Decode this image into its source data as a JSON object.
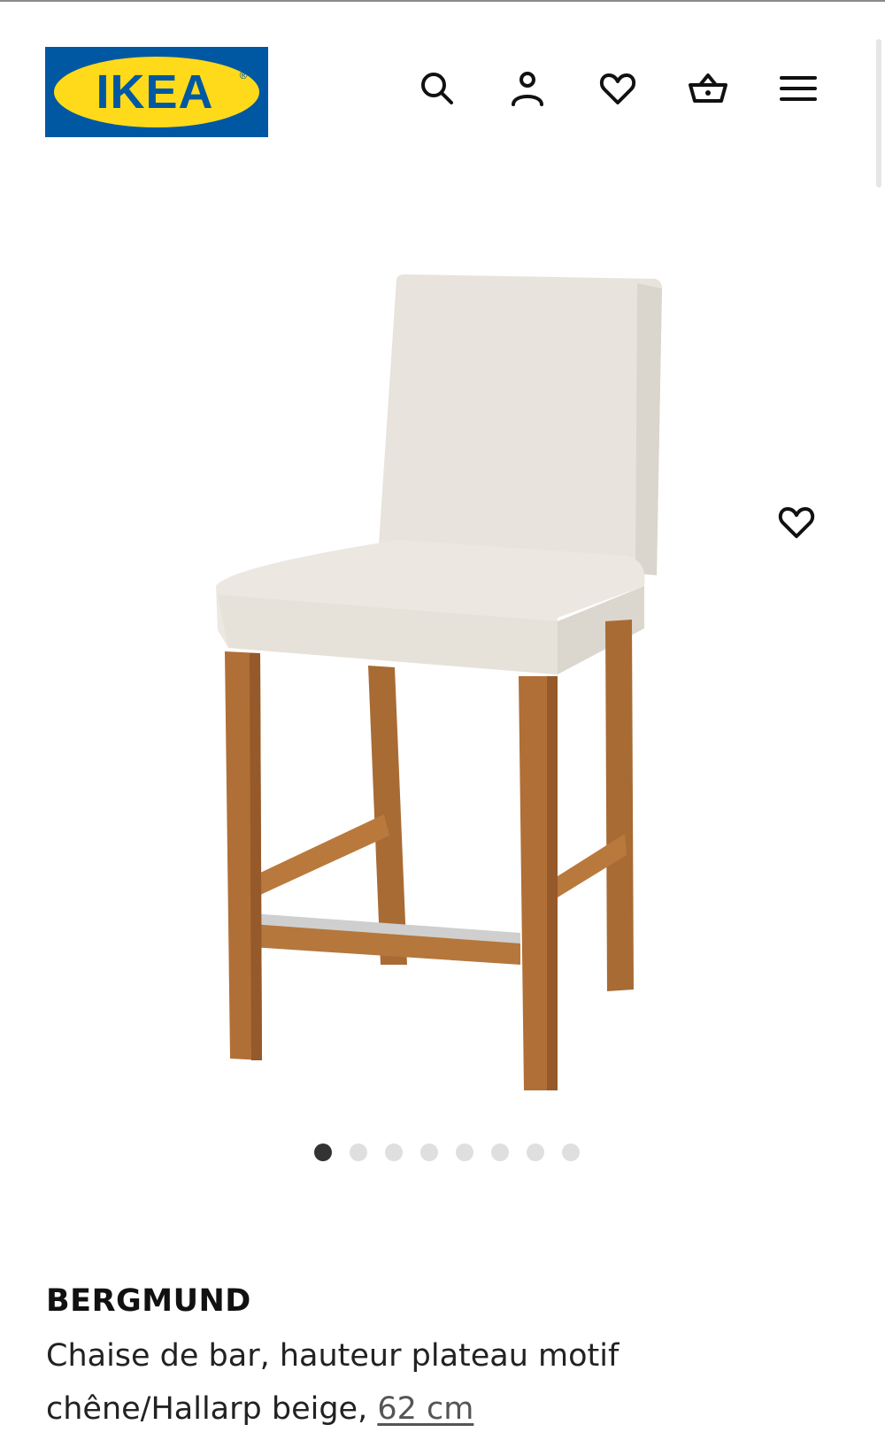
{
  "header": {
    "logo_text": "IKEA",
    "logo_registered": "®",
    "icons": {
      "search": "search-icon",
      "account": "person-icon",
      "favorites": "heart-icon",
      "cart": "shopping-basket-icon",
      "menu": "hamburger-menu-icon"
    }
  },
  "gallery": {
    "image": "product-photo-bar-stool",
    "favorite_icon": "heart-icon",
    "dot_count": 8,
    "active_dot": 0
  },
  "product": {
    "name": "BERGMUND",
    "description": "Chaise de bar, hauteur plateau motif chêne/Hallarp beige, ",
    "size_link": "62 cm"
  },
  "colors": {
    "brand_blue": "#0058A3",
    "brand_yellow": "#FFDA1A",
    "text": "#111111"
  }
}
